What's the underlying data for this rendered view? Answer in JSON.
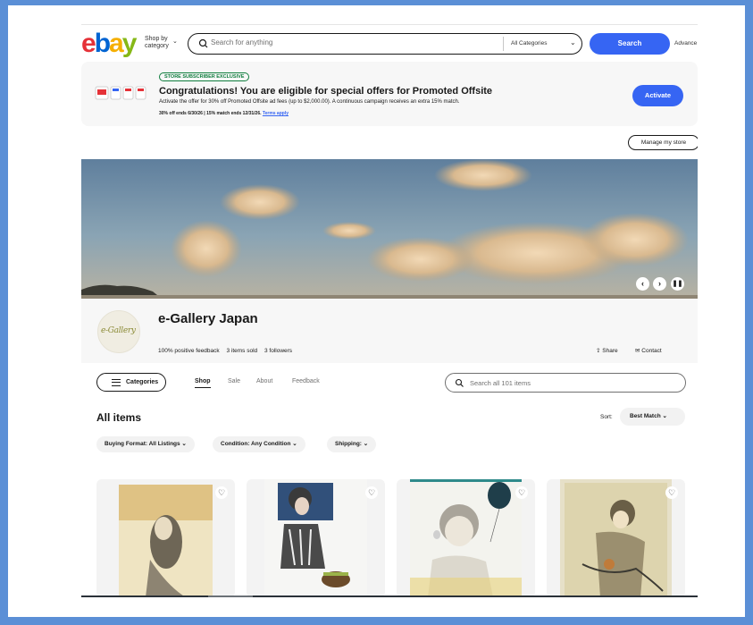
{
  "header": {
    "logo_letters": [
      "e",
      "b",
      "a",
      "y"
    ],
    "shop_by_category": "Shop by category",
    "search_placeholder": "Search for anything",
    "category_select": "All Categories",
    "search_button": "Search",
    "advanced": "Advance"
  },
  "promo": {
    "badge": "STORE SUBSCRIBER EXCLUSIVE",
    "title": "Congratulations! You are eligible for special offers for Promoted Offsite",
    "description": "Activate the offer for 30% off Promoted Offsite ad fees (up to $2,000.00). A continuous campaign receives an extra 15% match.",
    "fine_print": "30% off ends 6/30/26 | 15% match ends 12/31/26.",
    "terms_link": "Terms apply",
    "activate_button": "Activate"
  },
  "manage_store": "Manage my store",
  "store": {
    "avatar_text": "e-Gallery",
    "name": "e-Gallery Japan",
    "feedback": "100% positive feedback",
    "items_sold": "3 items sold",
    "followers": "3 followers",
    "share": "Share",
    "contact": "Contact"
  },
  "nav": {
    "categories_button": "Categories",
    "tabs": [
      "Shop",
      "Sale",
      "About",
      "Feedback"
    ],
    "active_tab": "Shop",
    "store_search_placeholder": "Search all 101 items"
  },
  "listing": {
    "heading": "All items",
    "sort_label": "Sort:",
    "sort_value": "Best Match",
    "filters": [
      "Buying Format: All Listings",
      "Condition: Any Condition",
      "Shipping:"
    ]
  },
  "colors": {
    "accent": "#3665f3",
    "frame": "#5b8fd6",
    "badge_green": "#0f7e3e"
  }
}
